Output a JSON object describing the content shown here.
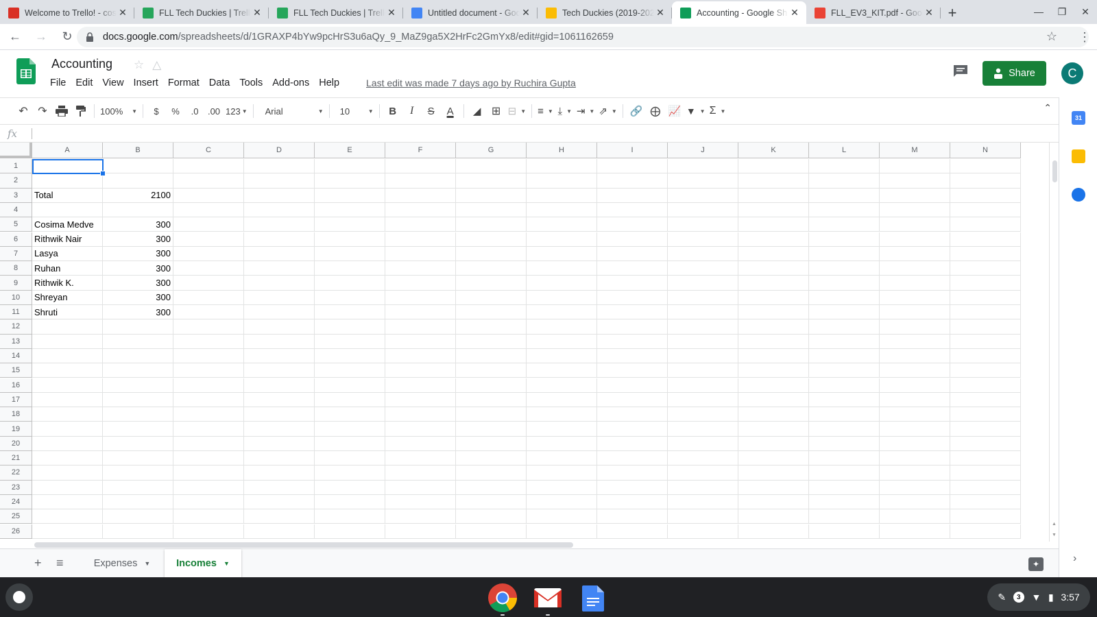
{
  "browser": {
    "tabs": [
      {
        "title": "Welcome to Trello! - cos",
        "favicon": "gmail-icon",
        "color": "#d93025",
        "active": false
      },
      {
        "title": "FLL Tech Duckies | Trello",
        "favicon": "trello-icon",
        "color": "#26a65b",
        "active": false
      },
      {
        "title": "FLL Tech Duckies | Trello",
        "favicon": "trello-icon",
        "color": "#26a65b",
        "active": false
      },
      {
        "title": "Untitled document - Goo",
        "favicon": "docs-icon",
        "color": "#4285f4",
        "active": false
      },
      {
        "title": "Tech Duckies (2019-202",
        "favicon": "drive-icon",
        "color": "#fbbc04",
        "active": false
      },
      {
        "title": "Accounting - Google Sh",
        "favicon": "sheets-icon",
        "color": "#0f9d58",
        "active": true
      },
      {
        "title": "FLL_EV3_KIT.pdf - Goog",
        "favicon": "pdf-icon",
        "color": "#ea4335",
        "active": false
      }
    ],
    "new_tab": "+",
    "url_host": "docs.google.com",
    "url_path": "/spreadsheets/d/1GRAXP4bYw9pcHrS3u6aQy_9_MaZ9ga5X2HrFc2GmYx8/edit#gid=1061162659"
  },
  "sheet": {
    "title": "Accounting",
    "menu": [
      "File",
      "Edit",
      "View",
      "Insert",
      "Format",
      "Data",
      "Tools",
      "Add-ons",
      "Help"
    ],
    "last_edit": "Last edit was made 7 days ago by Ruchira Gupta",
    "share_label": "Share",
    "avatar_letter": "C",
    "accent": "#188038"
  },
  "toolbar": {
    "zoom": "100%",
    "currency": "$",
    "percent": "%",
    "dec_less": ".0",
    "dec_more": ".00",
    "more_formats": "123",
    "font": "Arial",
    "font_size": "10",
    "bold": "B",
    "italic": "I",
    "strike": "S",
    "text_color": "A"
  },
  "formula_bar": {
    "fx": "fx",
    "value": ""
  },
  "grid": {
    "columns": [
      "A",
      "B",
      "C",
      "D",
      "E",
      "F",
      "G",
      "H",
      "I",
      "J",
      "K",
      "L",
      "M",
      "N"
    ],
    "rows": [
      "1",
      "2",
      "3",
      "4",
      "5",
      "6",
      "7",
      "8",
      "9",
      "10",
      "11",
      "12",
      "13",
      "14",
      "15",
      "16",
      "17",
      "18",
      "19",
      "20",
      "21",
      "22",
      "23",
      "24",
      "25",
      "26"
    ],
    "cells": [
      {
        "ref": "A3",
        "value": "Total"
      },
      {
        "ref": "B3",
        "value": "2100",
        "num": true
      },
      {
        "ref": "A5",
        "value": "Cosima Medve"
      },
      {
        "ref": "B5",
        "value": "300",
        "num": true
      },
      {
        "ref": "A6",
        "value": "Rithwik Nair"
      },
      {
        "ref": "B6",
        "value": "300",
        "num": true
      },
      {
        "ref": "A7",
        "value": "Lasya"
      },
      {
        "ref": "B7",
        "value": "300",
        "num": true
      },
      {
        "ref": "A8",
        "value": "Ruhan"
      },
      {
        "ref": "B8",
        "value": "300",
        "num": true
      },
      {
        "ref": "A9",
        "value": "Rithwik K."
      },
      {
        "ref": "B9",
        "value": "300",
        "num": true
      },
      {
        "ref": "A10",
        "value": "Shreyan"
      },
      {
        "ref": "B10",
        "value": "300",
        "num": true
      },
      {
        "ref": "A11",
        "value": "Shruti"
      },
      {
        "ref": "B11",
        "value": "300",
        "num": true
      }
    ],
    "selected": "A1"
  },
  "sheet_tabs": [
    {
      "label": "Expenses",
      "active": false
    },
    {
      "label": "Incomes",
      "active": true
    }
  ],
  "side_panel": [
    {
      "name": "calendar-icon",
      "label": "31",
      "color": "#4285f4"
    },
    {
      "name": "keep-icon",
      "label": "",
      "color": "#fbbc04"
    },
    {
      "name": "tasks-icon",
      "label": "",
      "color": "#1a73e8"
    }
  ],
  "shelf": {
    "apps": [
      {
        "name": "chrome-app-icon"
      },
      {
        "name": "gmail-app-icon"
      },
      {
        "name": "docs-app-icon"
      }
    ],
    "notifications": "3",
    "time": "3:57"
  }
}
